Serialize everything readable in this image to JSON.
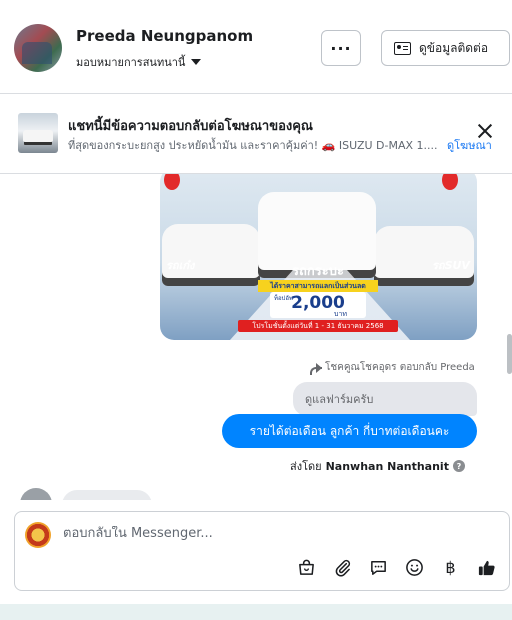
{
  "header": {
    "name": "Preeda Neungpanom",
    "assign_label": "มอบหมายการสนทนานี้",
    "more_label": "···",
    "contact_label": "ดูข้อมูลติดต่อ"
  },
  "ad_banner": {
    "title": "แชทนี้มีข้อความตอบกลับต่อโฆษณาของคุณ",
    "subtitle": "ที่สุดของกระบะยกสูง ประหยัดน้ำมัน และราคาคุ้มค่า! 🚗 ISUZU D-MAX 1....",
    "link_label": "ดูโฆษณา"
  },
  "ad_image": {
    "left_tag": "รถเก๋ง",
    "right_tag": "รถSUV",
    "center_title": "รถกระบะ",
    "yellow_text": "ได้ราคาสามารถแลกเป็นส่วนลด",
    "price_prefix": "ท็อปอัพ",
    "price": "2,000",
    "price_unit": "บาท",
    "promo_text": "โปรโมชั่นตั้งแต่วันที่ 1 - 31 ธันวาคม 2568"
  },
  "conversation": {
    "reply_meta": "โชคคูณโชคอุดร ตอบกลับ Preeda",
    "quoted_text": "ดูแลฟาร์มครับ",
    "message": "รายได้ต่อเดือน  ลูกค้า   กี่บาทต่อเดือนคะ",
    "sent_by_prefix": "ส่งโดย",
    "sent_by_name": "Nanwhan Nanthanit",
    "info_glyph": "?"
  },
  "composer": {
    "placeholder": "ตอบกลับใน Messenger...",
    "baht_symbol": "฿"
  },
  "colors": {
    "accent": "#0084ff",
    "link": "#1877f2"
  }
}
